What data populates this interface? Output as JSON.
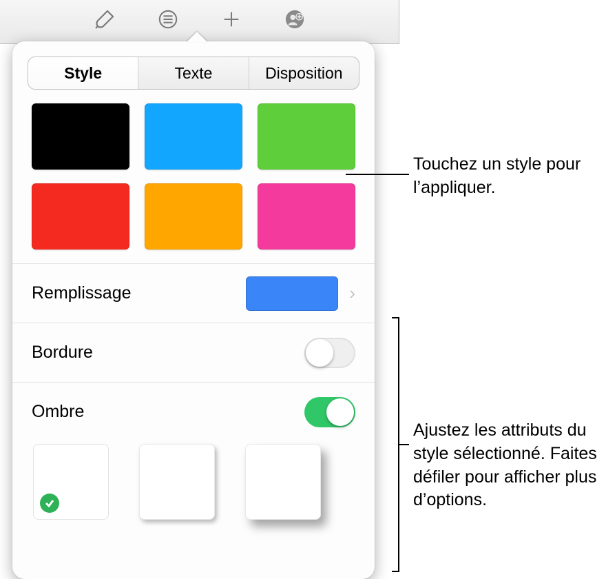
{
  "toolbar_icons": [
    "paintbrush-icon",
    "list-icon",
    "plus-icon",
    "collaborate-icon"
  ],
  "tabs": [
    {
      "label": "Style",
      "selected": true
    },
    {
      "label": "Texte",
      "selected": false
    },
    {
      "label": "Disposition",
      "selected": false
    }
  ],
  "style_swatches": [
    {
      "color": "#000000"
    },
    {
      "color": "#12a6ff"
    },
    {
      "color": "#5ece3a"
    },
    {
      "color": "#f4291f"
    },
    {
      "color": "#ffa600"
    },
    {
      "color": "#f43a9c"
    }
  ],
  "rows": {
    "fill": {
      "label": "Remplissage",
      "swatch_color": "#3a85f7"
    },
    "border": {
      "label": "Bordure",
      "on": false
    },
    "shadow": {
      "label": "Ombre",
      "on": true
    }
  },
  "shadow_presets": [
    {
      "selected": true
    },
    {
      "selected": false
    },
    {
      "selected": false
    }
  ],
  "callouts": {
    "apply_style": "Touchez un style pour l’appliquer.",
    "adjust": "Ajustez les attributs du style sélectionné. Faites défiler pour afficher plus d’options."
  }
}
